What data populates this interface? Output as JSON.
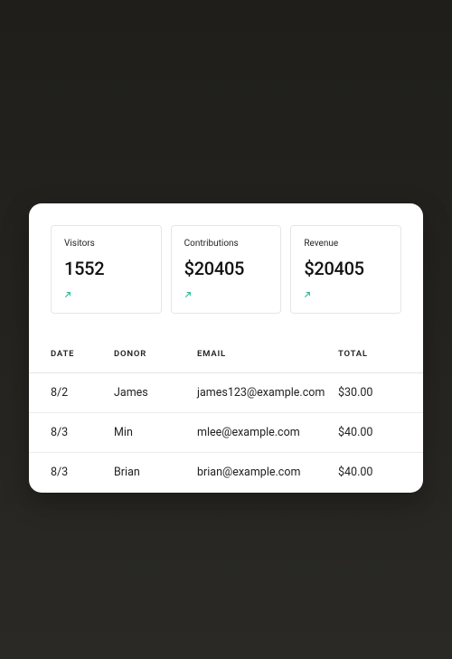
{
  "stats": [
    {
      "label": "Visitors",
      "value": "1552",
      "trend": "up"
    },
    {
      "label": "Contributions",
      "value": "$20405",
      "trend": "up"
    },
    {
      "label": "Revenue",
      "value": "$20405",
      "trend": "up"
    }
  ],
  "table": {
    "headers": {
      "date": "DATE",
      "donor": "DONOR",
      "email": "EMAIL",
      "total": "TOTAL"
    },
    "rows": [
      {
        "date": "8/2",
        "donor": "James",
        "email": "james123@example.com",
        "total": "$30.00"
      },
      {
        "date": "8/3",
        "donor": "Min",
        "email": "mlee@example.com",
        "total": "$40.00"
      },
      {
        "date": "8/3",
        "donor": "Brian",
        "email": "brian@example.com",
        "total": "$40.00"
      }
    ]
  },
  "colors": {
    "trend_up": "#2fb898"
  }
}
